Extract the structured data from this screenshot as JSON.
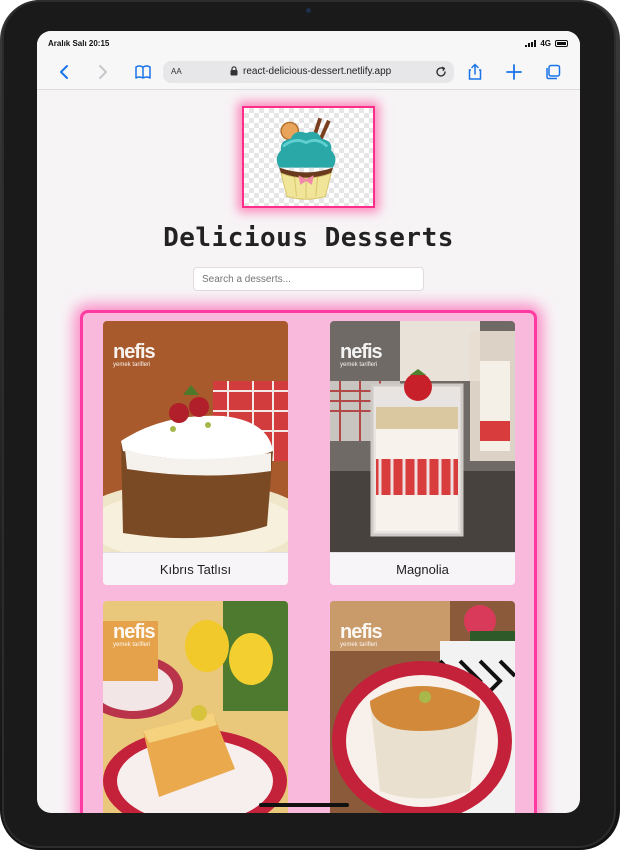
{
  "status": {
    "time": "Aralık Salı 20:15",
    "network": "4G"
  },
  "browser": {
    "aa": "AA",
    "url": "react-delicious-dessert.netlify.app"
  },
  "header": {
    "title": "Delicious Desserts"
  },
  "search": {
    "placeholder": "Search a desserts..."
  },
  "brand": {
    "name": "nefis",
    "tagline": "yemek tarifleri"
  },
  "desserts": [
    {
      "name": "Kıbrıs Tatlısı"
    },
    {
      "name": "Magnolia"
    },
    {
      "name": ""
    },
    {
      "name": ""
    }
  ],
  "colors": {
    "accent": "#ff2d8a",
    "panel": "#f9b9dd",
    "link": "#1a73e8"
  }
}
